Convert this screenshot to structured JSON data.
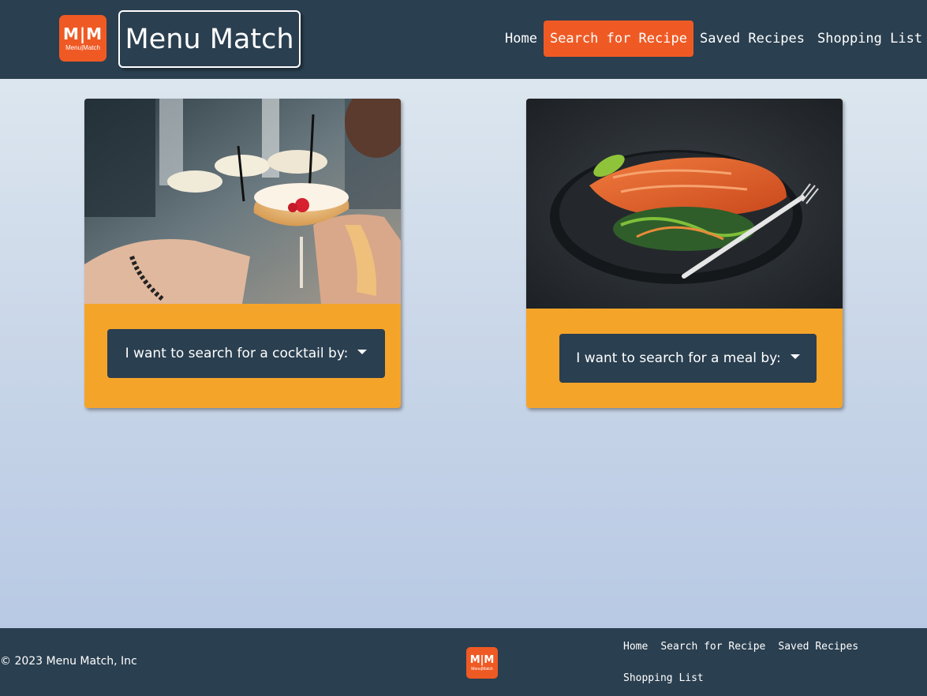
{
  "header": {
    "logo": {
      "top": "M|M",
      "bottom": "Menu|Match",
      "color": "#ef5a24"
    },
    "brand_title": "Menu Match",
    "nav": [
      {
        "label": "Home"
      },
      {
        "label": "Search for Recipe",
        "active": true
      },
      {
        "label": "Saved Recipes"
      },
      {
        "label": "Shopping List"
      }
    ]
  },
  "cards": {
    "cocktail": {
      "dropdown_label": "I want to search for a cocktail by:"
    },
    "meal": {
      "dropdown_label": "I want to search for a meal by:"
    }
  },
  "footer": {
    "copyright": "© 2023 Menu Match, Inc",
    "logo": {
      "top": "M|M",
      "bottom": "Menu|Match"
    },
    "nav": [
      {
        "label": "Home"
      },
      {
        "label": "Search for Recipe"
      },
      {
        "label": "Saved Recipes"
      },
      {
        "label": "Shopping List"
      }
    ]
  },
  "colors": {
    "navy": "#2a3f50",
    "accent_orange": "#ef5a24",
    "card_orange": "#f5a42a"
  }
}
